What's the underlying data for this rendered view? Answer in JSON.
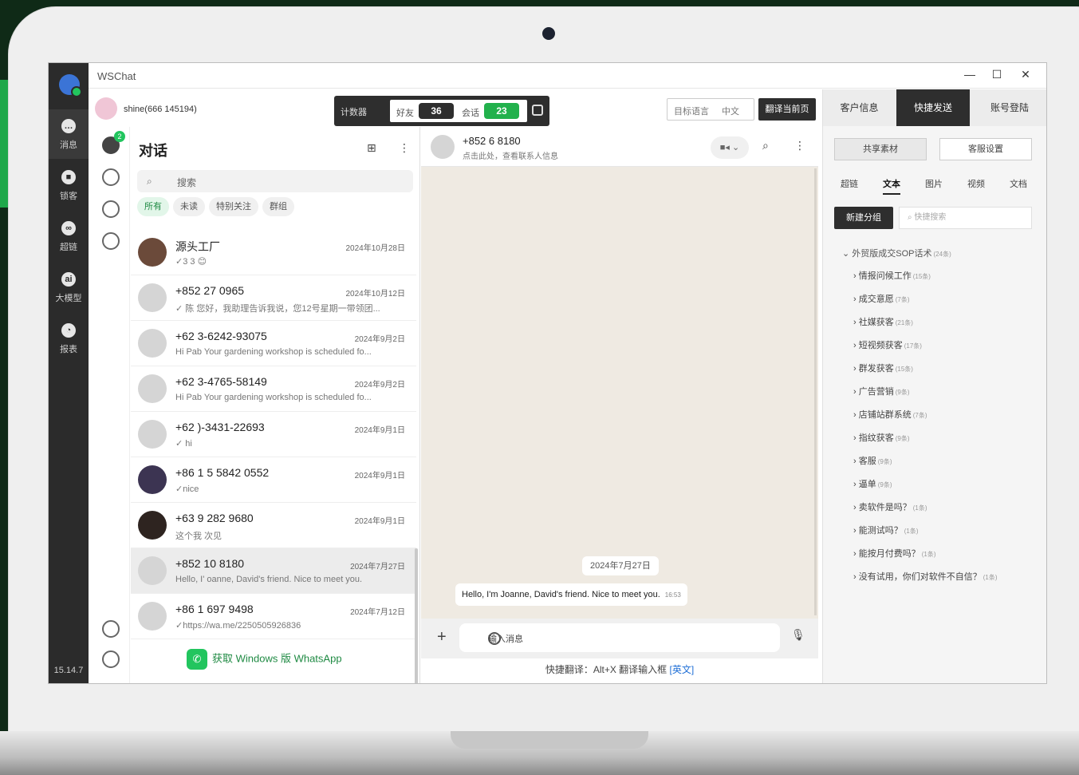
{
  "window": {
    "title": "WSChat",
    "minimize": "—",
    "maximize": "☐",
    "close": "✕"
  },
  "rail": {
    "items": [
      {
        "label": "消息",
        "icon": "message-icon"
      },
      {
        "label": "锁客",
        "icon": "lock-icon"
      },
      {
        "label": "超链",
        "icon": "link-icon"
      },
      {
        "label": "大模型",
        "icon": "ai-model-icon"
      },
      {
        "label": "报表",
        "icon": "report-icon"
      }
    ],
    "version": "15.14.7"
  },
  "account": {
    "name": "shine(666   145194)"
  },
  "counter": {
    "label": "计数器",
    "friends_label": "好友",
    "friends_value": "36",
    "sessions_label": "会话",
    "sessions_value": "23"
  },
  "translate": {
    "target_lang": "目标语言",
    "lang": "中文",
    "button": "翻译当前页"
  },
  "subnav": {
    "badge": "2"
  },
  "conversations": {
    "heading": "对话",
    "search_placeholder": "搜索",
    "filters": [
      "所有",
      "未读",
      "特别关注",
      "群组"
    ],
    "items": [
      {
        "name": "源头工厂",
        "date": "2024年10月28日",
        "msg": "✓3     3 😊"
      },
      {
        "name": "+852   27 0965",
        "date": "2024年10月12日",
        "msg": "✓ 陈    您好，我助理告诉我说，您12号星期一带领团..."
      },
      {
        "name": "+62   3-6242-93075",
        "date": "2024年9月2日",
        "msg": "Hi Pab    Your gardening workshop is scheduled fo..."
      },
      {
        "name": "+62   3-4765-58149",
        "date": "2024年9月2日",
        "msg": "Hi Pab    Your gardening workshop is scheduled fo..."
      },
      {
        "name": "+62   )-3431-22693",
        "date": "2024年9月1日",
        "msg": "✓ hi"
      },
      {
        "name": "+86 1  5 5842 0552",
        "date": "2024年9月1日",
        "msg": "✓nice"
      },
      {
        "name": "+63 9   282 9680",
        "date": "2024年9月1日",
        "msg": "这个我    次见"
      },
      {
        "name": "+852     10 8180",
        "date": "2024年7月27日",
        "msg": "Hello, I'   oanne, David's friend. Nice to meet you."
      },
      {
        "name": "+86 1     697 9498",
        "date": "2024年7月12日",
        "msg": "✓https://wa.me/2250505926836"
      }
    ],
    "get_windows": "获取 Windows 版 WhatsApp"
  },
  "chat": {
    "contact_name": "+852 6    8180",
    "contact_sub": "点击此处，查看联系人信息",
    "date_chip": "2024年7月27日",
    "message": "Hello, I'm Joanne, David's friend. Nice to meet you.",
    "message_time": "16:53",
    "input_placeholder": "输入消息",
    "shortcut_text": "快捷翻译：Alt+X 翻译输入框",
    "shortcut_lang": "[英文]"
  },
  "right_panel": {
    "tabs": [
      "客户信息",
      "快捷发送",
      "账号登陆"
    ],
    "buttons": [
      "共享素材",
      "客服设置"
    ],
    "media_tabs": [
      "超链",
      "文本",
      "图片",
      "视频",
      "文档"
    ],
    "new_group": "新建分组",
    "quick_search": "快捷搜索",
    "root": {
      "label": "外贸版成交SOP话术",
      "count": "(24条)"
    },
    "nodes": [
      {
        "label": "情报问候工作",
        "count": "(15条)"
      },
      {
        "label": "成交意愿",
        "count": "(7条)"
      },
      {
        "label": "社媒获客",
        "count": "(21条)"
      },
      {
        "label": "短视频获客",
        "count": "(17条)"
      },
      {
        "label": "群发获客",
        "count": "(15条)"
      },
      {
        "label": "广告营销",
        "count": "(9条)"
      },
      {
        "label": "店铺站群系统",
        "count": "(7条)"
      },
      {
        "label": "指纹获客",
        "count": "(9条)"
      },
      {
        "label": "客服",
        "count": "(9条)"
      },
      {
        "label": "逼单",
        "count": "(9条)"
      },
      {
        "label": "卖软件是吗？",
        "count": "(1条)"
      },
      {
        "label": "能测试吗？",
        "count": "(1条)"
      },
      {
        "label": "能按月付费吗？",
        "count": "(1条)"
      },
      {
        "label": "没有试用，你们对软件不自信？",
        "count": "(1条)"
      }
    ]
  }
}
